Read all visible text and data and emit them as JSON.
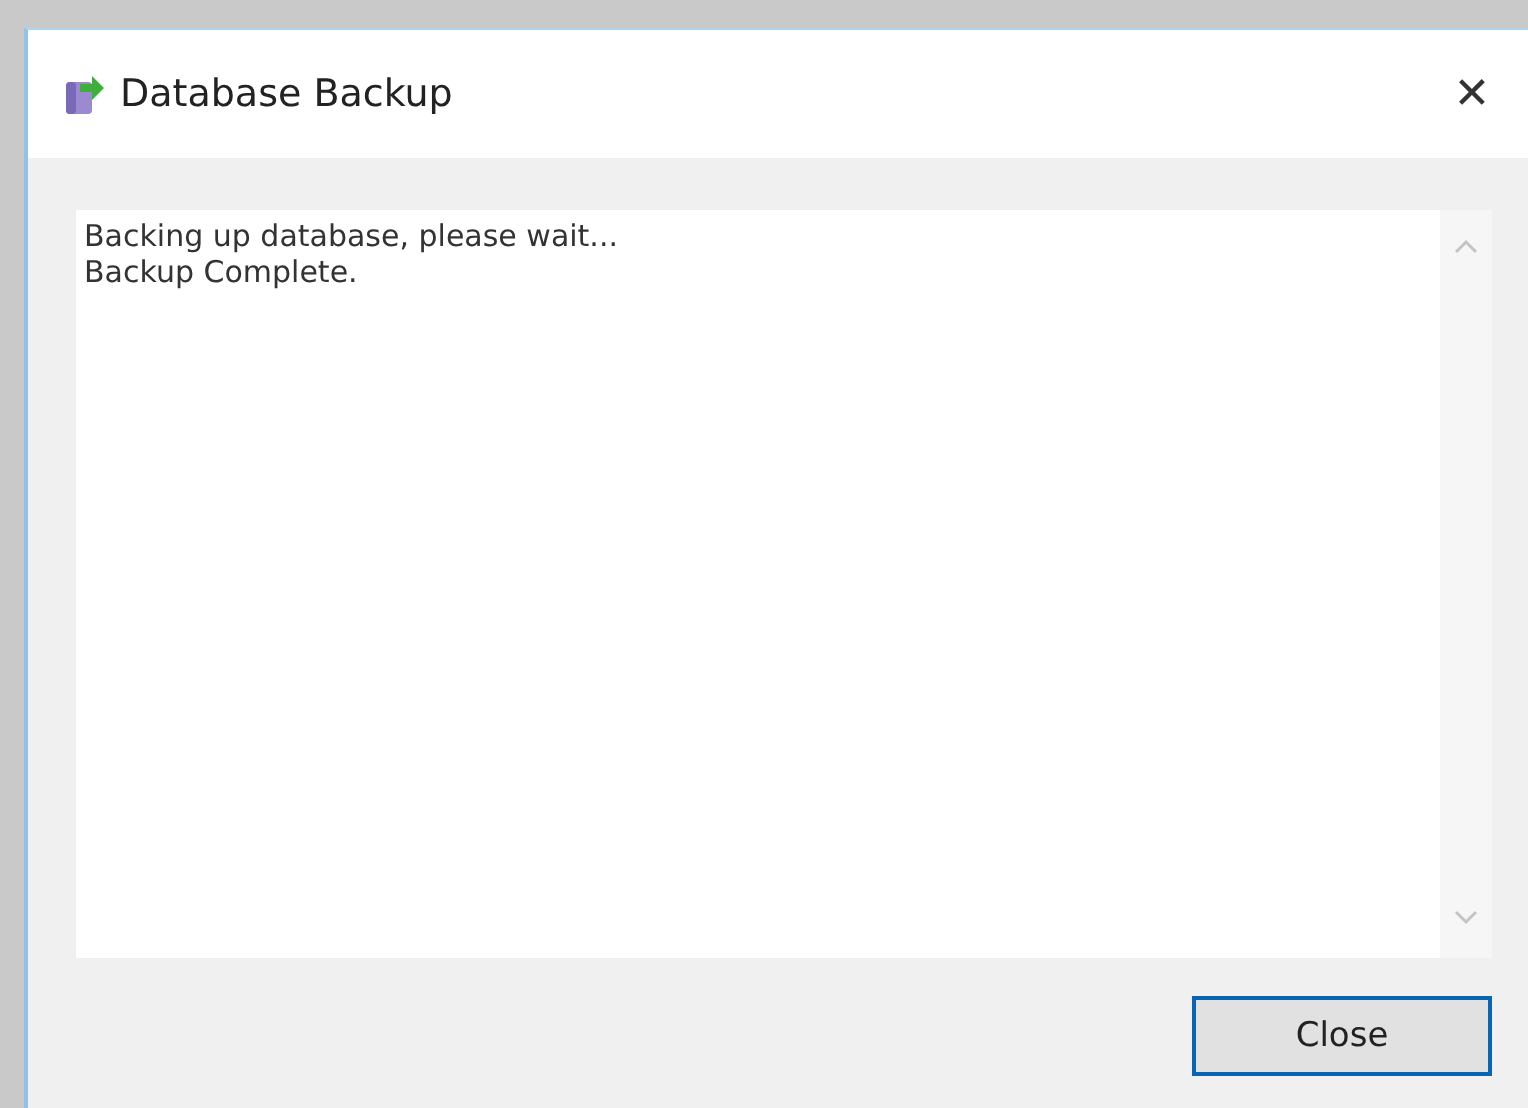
{
  "window": {
    "title": "Database Backup",
    "close_glyph": "✕"
  },
  "log": {
    "lines": [
      "Backing up database, please wait...",
      "Backup Complete."
    ]
  },
  "buttons": [
    {
      "label": "Close",
      "focused": true
    }
  ]
}
